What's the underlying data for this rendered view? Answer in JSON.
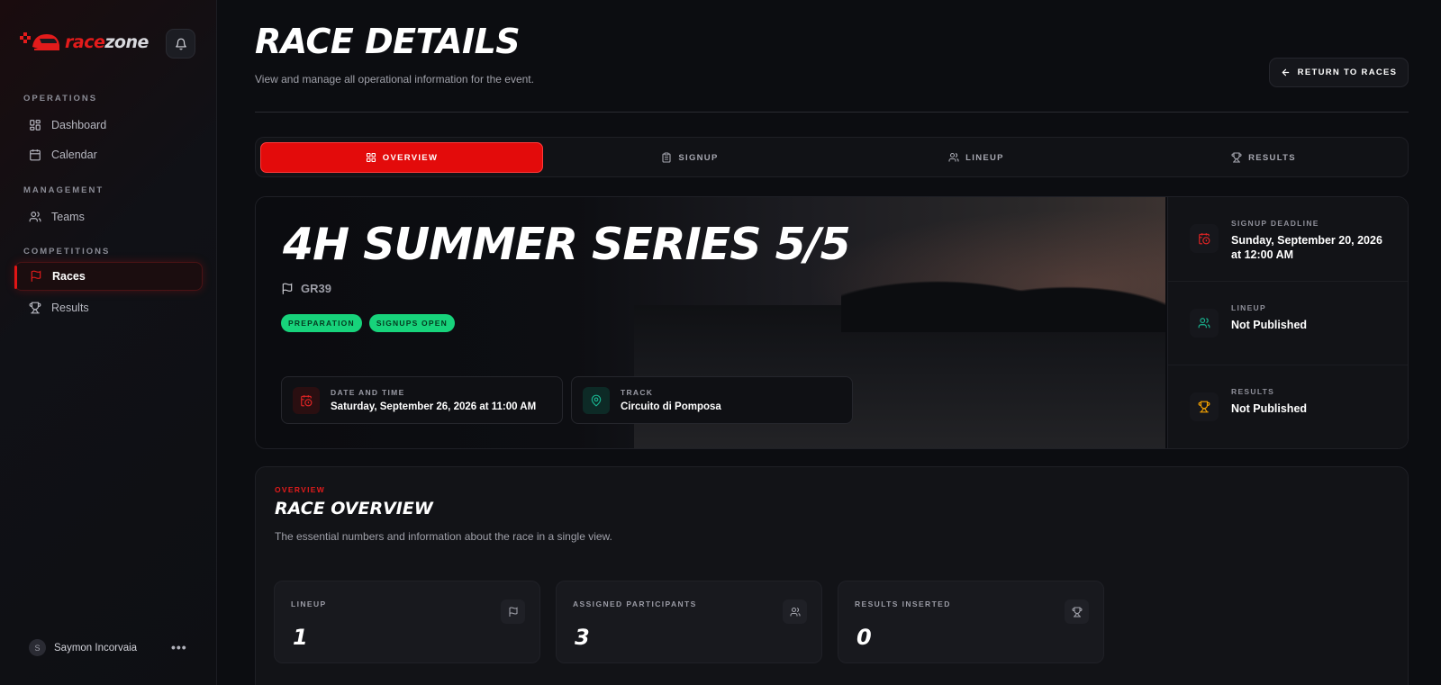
{
  "brand": {
    "name_part1": "race",
    "name_part2": "zone"
  },
  "sidebar": {
    "sections": [
      {
        "label": "OPERATIONS"
      },
      {
        "label": "MANAGEMENT"
      },
      {
        "label": "COMPETITIONS"
      }
    ],
    "items": [
      {
        "label": "Dashboard",
        "icon": "grid-icon"
      },
      {
        "label": "Calendar",
        "icon": "calendar-icon"
      },
      {
        "label": "Teams",
        "icon": "users-icon"
      },
      {
        "label": "Races",
        "icon": "flag-icon",
        "active": true
      },
      {
        "label": "Results",
        "icon": "trophy-icon"
      }
    ],
    "user": {
      "initial": "S",
      "name": "Saymon Incorvaia",
      "more": "•••"
    }
  },
  "header": {
    "title": "RACE DETAILS",
    "subtitle": "View and manage all operational information for the event.",
    "return_label": "RETURN TO RACES"
  },
  "tabs": [
    {
      "label": "OVERVIEW",
      "icon": "grid-icon",
      "active": true
    },
    {
      "label": "SIGNUP",
      "icon": "clipboard-icon"
    },
    {
      "label": "LINEUP",
      "icon": "users-icon"
    },
    {
      "label": "RESULTS",
      "icon": "trophy-icon"
    }
  ],
  "race": {
    "title": "4H SUMMER SERIES 5/5",
    "car_class": "GR39",
    "badges": [
      "PREPARATION",
      "SIGNUPS OPEN"
    ],
    "date_label": "DATE AND TIME",
    "date_value": "Saturday, September 26, 2026 at 11:00 AM",
    "track_label": "TRACK",
    "track_value": "Circuito di Pomposa"
  },
  "status_panel": [
    {
      "label": "SIGNUP DEADLINE",
      "value": "Sunday, September 20, 2026 at 12:00 AM",
      "icon": "calendar-clock-icon",
      "color": "#e02424"
    },
    {
      "label": "LINEUP",
      "value": "Not Published",
      "icon": "users-icon",
      "color": "#19b38f"
    },
    {
      "label": "RESULTS",
      "value": "Not Published",
      "icon": "trophy-icon",
      "color": "#f5a300"
    }
  ],
  "overview": {
    "kicker": "OVERVIEW",
    "title": "RACE OVERVIEW",
    "description": "The essential numbers and information about the race in a single view.",
    "stats": [
      {
        "label": "LINEUP",
        "value": "1",
        "icon": "flag-icon"
      },
      {
        "label": "ASSIGNED PARTICIPANTS",
        "value": "3",
        "icon": "users-icon"
      },
      {
        "label": "RESULTS INSERTED",
        "value": "0",
        "icon": "trophy-icon"
      }
    ]
  },
  "colors": {
    "accent": "#e30b0b",
    "success": "#17d37b",
    "teal": "#19b38f",
    "gold": "#f5a300"
  }
}
